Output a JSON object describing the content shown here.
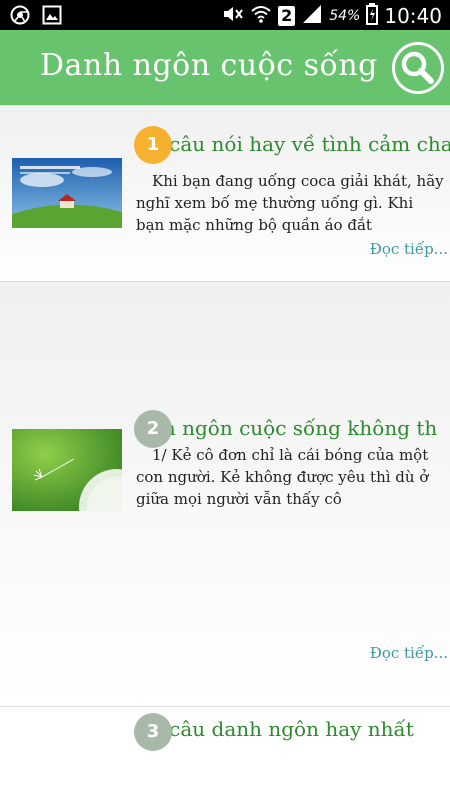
{
  "status_bar": {
    "battery_percent": "54%",
    "sim_slot": "2",
    "time": "10:40",
    "icons": [
      "chrome-icon",
      "gallery-icon",
      "mute-icon",
      "wifi-icon",
      "signal-icon",
      "battery-icon"
    ]
  },
  "app_bar": {
    "title": "Danh ngôn cuộc sống",
    "search_icon": "search-icon",
    "color": "#68c36f"
  },
  "items": [
    {
      "number": "1",
      "title": "g câu nói hay về tình cảm cha",
      "excerpt": "Khi bạn đang uống coca giải khát, hãy nghĩ xem bố mẹ thường uống gì. Khi bạn mặc những bộ quần áo đắt",
      "read_more": "Đọc tiếp...",
      "badge_color": "#f5b12f"
    },
    {
      "number": "2",
      "title": "nh ngôn cuộc sống không th",
      "excerpt": "1/ Kẻ cô đơn chỉ là cái bóng của một con người. Kẻ không được yêu thì dù ở giữa mọi người vẫn thấy cô",
      "read_more": "Đọc tiếp...",
      "badge_color": "#a8b9a9"
    },
    {
      "number": "3",
      "title": "g câu danh ngôn hay nhất",
      "badge_color": "#a8b9a9"
    }
  ]
}
